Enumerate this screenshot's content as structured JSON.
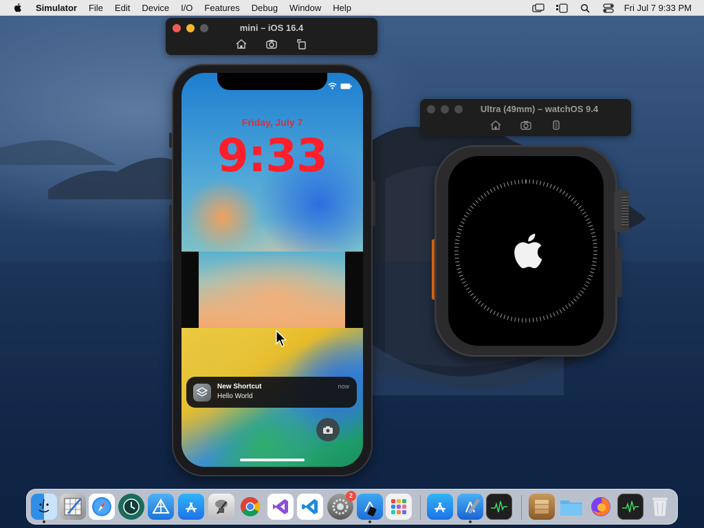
{
  "menubar": {
    "app_name": "Simulator",
    "items": [
      "File",
      "Edit",
      "Device",
      "I/O",
      "Features",
      "Debug",
      "Window",
      "Help"
    ],
    "clock": "Fri Jul 7  9:33 PM"
  },
  "iphone_window": {
    "title": "mini – iOS 16.4",
    "tools": [
      "home-icon",
      "screenshot-icon",
      "rotate-icon"
    ]
  },
  "watch_window": {
    "title": "Ultra (49mm) – watchOS 9.4",
    "tools": [
      "home-icon",
      "screenshot-icon",
      "side-button-icon"
    ]
  },
  "lockscreen": {
    "date": "Friday, July 7",
    "time": "9:33",
    "notification": {
      "title": "New Shortcut",
      "body": "Hello World",
      "time": "now"
    }
  },
  "dock": {
    "settings_badge": "2",
    "apps": [
      "Finder",
      "Simulator",
      "Safari",
      "Time Machine",
      "Network Radar",
      "App Store",
      "Keychain Access",
      "Chrome",
      "Visual Studio",
      "VS Code",
      "System Settings",
      "Xcode Simulator Tool",
      "Launchpad",
      "App Store",
      "Xcode",
      "Activity Monitor",
      "Archive",
      "Folder",
      "Firefox",
      "Activity Monitor",
      "Trash"
    ]
  },
  "colors": {
    "lock_time": "#ff1f2a",
    "light_close": "#5b5b5d",
    "light_min": "#f5b82a",
    "orange_button": "#ff7a1a"
  }
}
